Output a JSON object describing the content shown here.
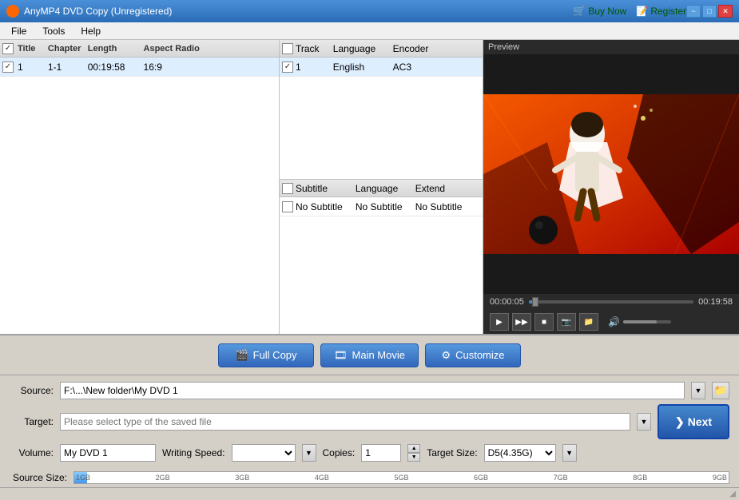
{
  "titlebar": {
    "title": "AnyMP4 DVD Copy (Unregistered)",
    "buy_label": "Buy Now",
    "register_label": "Register"
  },
  "menu": {
    "items": [
      "File",
      "Tools",
      "Help"
    ]
  },
  "title_table": {
    "headers": [
      "",
      "Title",
      "Chapter",
      "Length",
      "Aspect Radio"
    ],
    "rows": [
      {
        "checked": true,
        "title": "1",
        "chapter": "1-1",
        "length": "00:19:58",
        "aspect": "16:9"
      }
    ]
  },
  "track_table": {
    "headers": [
      "",
      "Track",
      "Language",
      "Encoder"
    ],
    "rows": [
      {
        "checked": true,
        "track": "1",
        "language": "English",
        "encoder": "AC3"
      }
    ]
  },
  "subtitle_table": {
    "headers": [
      "",
      "Subtitle",
      "Language",
      "Extend"
    ],
    "rows": [
      {
        "checked": false,
        "subtitle": "No Subtitle",
        "language": "No Subtitle",
        "extend": "No Subtitle"
      }
    ]
  },
  "preview": {
    "label": "Preview",
    "time_current": "00:00:05",
    "time_total": "00:19:58"
  },
  "action_buttons": {
    "full_copy": "Full Copy",
    "main_movie": "Main Movie",
    "customize": "Customize"
  },
  "settings": {
    "source_label": "Source:",
    "source_value": "F:\\...\\New folder\\My DVD 1",
    "target_label": "Target:",
    "target_placeholder": "Please select type of the saved file",
    "volume_label": "Volume:",
    "volume_value": "My DVD 1",
    "writing_speed_label": "Writing Speed:",
    "copies_label": "Copies:",
    "copies_value": "1",
    "target_size_label": "Target Size:",
    "target_size_value": "D5(4.35G)",
    "source_size_label": "Source Size:",
    "next_label": "Next"
  },
  "size_bar_ticks": [
    "1GB",
    "2GB",
    "3GB",
    "4GB",
    "5GB",
    "6GB",
    "7GB",
    "8GB",
    "9GB"
  ],
  "icons": {
    "play": "▶",
    "fast_forward": "▶▶",
    "stop": "■",
    "camera": "📷",
    "folder_open": "📂",
    "volume": "🔊",
    "cart": "🛒",
    "register": "📝",
    "chevron_down": "▼",
    "chevron_right": "❯",
    "film": "🎬",
    "gear": "⚙"
  }
}
